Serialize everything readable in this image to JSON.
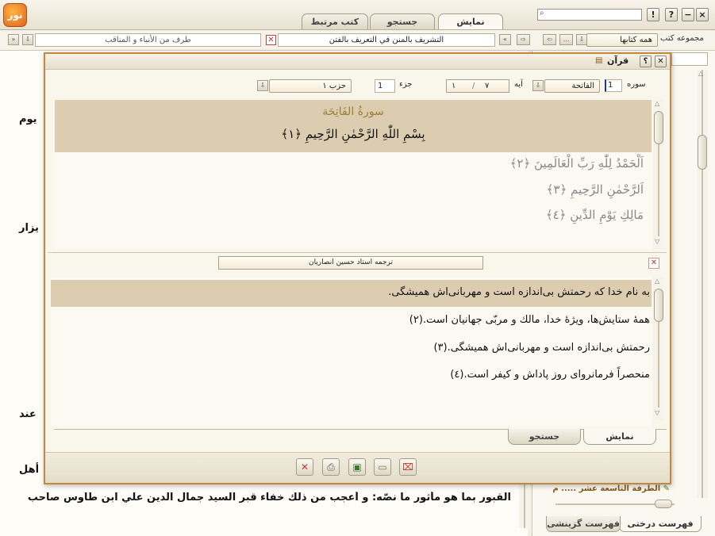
{
  "app": {
    "logo_text": "نور",
    "window_buttons": [
      "×",
      "−",
      "?",
      "!"
    ],
    "main_tabs": [
      {
        "label": "نمایش",
        "active": true
      },
      {
        "label": "جستجو",
        "active": false
      },
      {
        "label": "کتب مرتبط",
        "active": false
      }
    ]
  },
  "toolbar": {
    "collection_label": "مجموعه کتب",
    "collection_value": "همه کتابها",
    "book_title": "التشريف بالمنن في التعريف بالفتن",
    "section_value": "طرف من الأنباء و المناقب",
    "ellipsis": "..."
  },
  "background_text": {
    "lines": [
      "يوم",
      "يزار",
      "عند",
      "أهل"
    ],
    "bottom_line": "القبور بما هو مأثور ما نصّه: و أعجب من ذلك خفاء قبر السيد جمال الدين علي ابن طاوس صاحب"
  },
  "tree_panel": {
    "item_text": "الطرفة التاسعة عشر ..... م",
    "tabs": [
      {
        "label": "فهرست درختی",
        "active": true
      },
      {
        "label": "فهرست گزینشی",
        "active": false
      }
    ]
  },
  "quran_dialog": {
    "title": "قرآن",
    "help": "؟",
    "selectors": {
      "surah_label": "سوره",
      "surah_number": "1",
      "surah_name": "الفاتحة",
      "ayah_label": "آيه",
      "ayah_from": "۷",
      "ayah_to": "۱",
      "juz_label": "جزء",
      "juz_value": "1",
      "hizb_value": "حزب ۱"
    },
    "surah_header": "سورةُ الفَاتِحَة",
    "verses": [
      "بِسْمِ اللّٰهِ الرَّحْمٰنِ الرَّحِيمِ ﴿١﴾",
      "اَلْحَمْدُ لِلّٰهِ رَبِّ الْعَالَمِينَ ﴿٢﴾",
      "اَلرَّحْمٰنِ الرَّحِيمِ ﴿٣﴾",
      "مَالِكِ يَوْمِ الدِّينِ ﴿٤﴾"
    ],
    "translation_selector": "ترجمه استاد حسين انصاريان",
    "translations": [
      "به نام خدا كه رحمتش بی‌اندازه است و مهربانی‌اش هميشگی.",
      "همهٔ ستايش‌ها، ويژهٔ خدا، مالك و مربّی جهانيان است.(٢)",
      "رحمتش بی‌اندازه است و مهربانی‌اش هميشگی.(٣)",
      "منحصراً فرمانروای روز پاداش و كيفر است.(٤)"
    ],
    "bottom_tabs": [
      {
        "label": "نمایش",
        "active": true
      },
      {
        "label": "جستجو",
        "active": false
      }
    ]
  },
  "colors": {
    "highlight_row": "#dccdb0",
    "surah_gold": "#9c7f3a",
    "dialog_border": "#c3883f",
    "close_red": "#c0392b"
  }
}
